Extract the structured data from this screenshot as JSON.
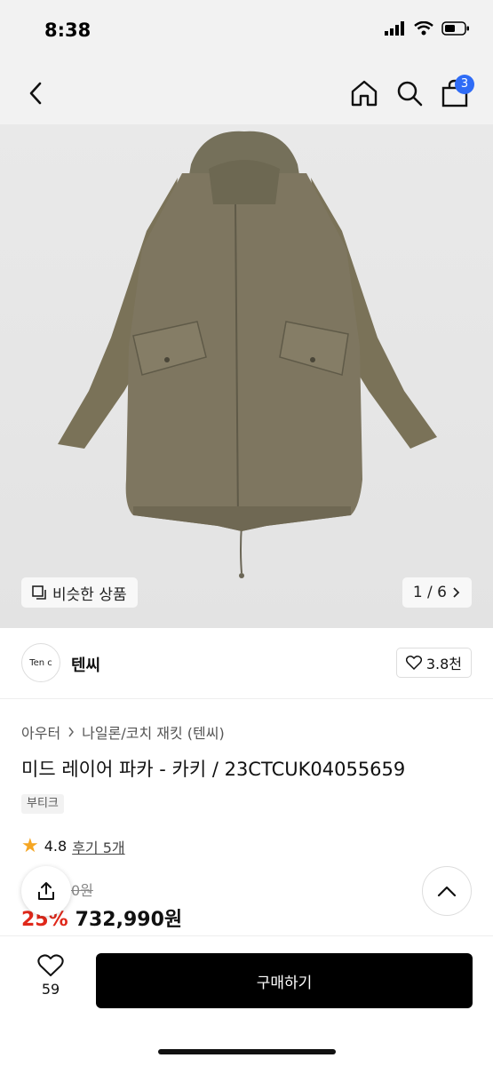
{
  "status": {
    "time": "8:38"
  },
  "nav": {
    "cart_count": "3"
  },
  "hero": {
    "similar_label": "비슷한 상품",
    "page_indicator": "1 / 6"
  },
  "brand": {
    "logo_text": "Ten c",
    "name": "텐씨",
    "likes": "3.8천"
  },
  "breadcrumb": {
    "level1": "아우터",
    "level2": "나일론/코치 재킷 (텐씨)"
  },
  "product": {
    "title": "미드 레이어 파카 - 카키 / 23CTCUK04055659",
    "tag": "부티크",
    "rating": "4.8",
    "review_link": "후기 5개",
    "original_price": "0원",
    "discount": "25%",
    "price": "732,990원"
  },
  "bottom": {
    "wish_count": "59",
    "buy_label": "구매하기"
  },
  "colors": {
    "cart_badge": "#2f6cf6",
    "discount": "#e0281a",
    "star": "#f5a623",
    "jacket": "#7a7258"
  },
  "icons": [
    "back-icon",
    "home-icon",
    "search-icon",
    "bag-icon",
    "similar-icon",
    "chevron-right-icon",
    "heart-icon",
    "star-icon",
    "share-icon",
    "chevron-up-icon"
  ]
}
